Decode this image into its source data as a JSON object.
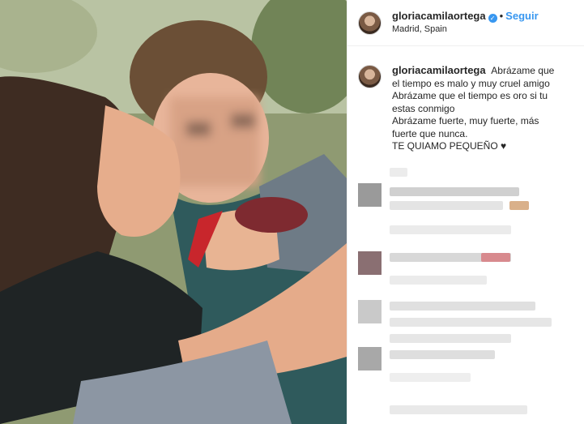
{
  "post": {
    "username": "gloriacamilaortega",
    "follow_label": "Seguir",
    "separator": "•",
    "location": "Madrid, Spain",
    "verified_icon": "✓"
  },
  "caption": {
    "username": "gloriacamilaortega",
    "lines": [
      "Abrázame que",
      "el tiempo es malo y muy cruel amigo",
      "Abrázame que el tiempo es oro si tu",
      "estas conmigo",
      "Abrázame fuerte, muy fuerte, más",
      "fuerte que nunca.",
      "TE QUIAMO PEQUEÑO ♥"
    ]
  },
  "colors": {
    "accent": "#3897f0",
    "text": "#262626",
    "border": "#efefef"
  }
}
